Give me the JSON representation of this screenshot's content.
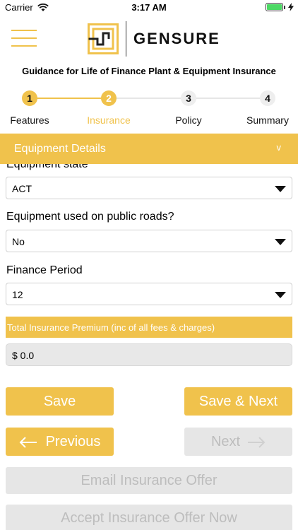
{
  "status_bar": {
    "carrier": "Carrier",
    "time": "3:17 AM"
  },
  "header": {
    "brand": "GENSURE"
  },
  "guidance": "Guidance for Life of Finance Plant & Equipment Insurance",
  "stepper": {
    "steps": [
      {
        "number": "1",
        "label": "Features"
      },
      {
        "number": "2",
        "label": "Insurance"
      },
      {
        "number": "3",
        "label": "Policy"
      },
      {
        "number": "4",
        "label": "Summary"
      }
    ],
    "active_index": 2
  },
  "accordion": {
    "title": "Equipment Details",
    "chevron": "v"
  },
  "form": {
    "state_label": "Equipment state",
    "state_value": "ACT",
    "public_roads_label": "Equipment used on public roads?",
    "public_roads_value": "No",
    "finance_label": "Finance Period",
    "finance_value": "12",
    "premium_label": "Total Insurance Premium (inc of all fees & charges)",
    "premium_value": "$ 0.0"
  },
  "buttons": {
    "save": "Save",
    "save_next": "Save & Next",
    "previous": "Previous",
    "next": "Next",
    "email_offer": "Email Insurance Offer",
    "accept_offer": "Accept Insurance Offer Now"
  },
  "colors": {
    "accent": "#f0c24c",
    "disabled": "#e6e6e6",
    "disabled_text": "#bdbdbd"
  }
}
